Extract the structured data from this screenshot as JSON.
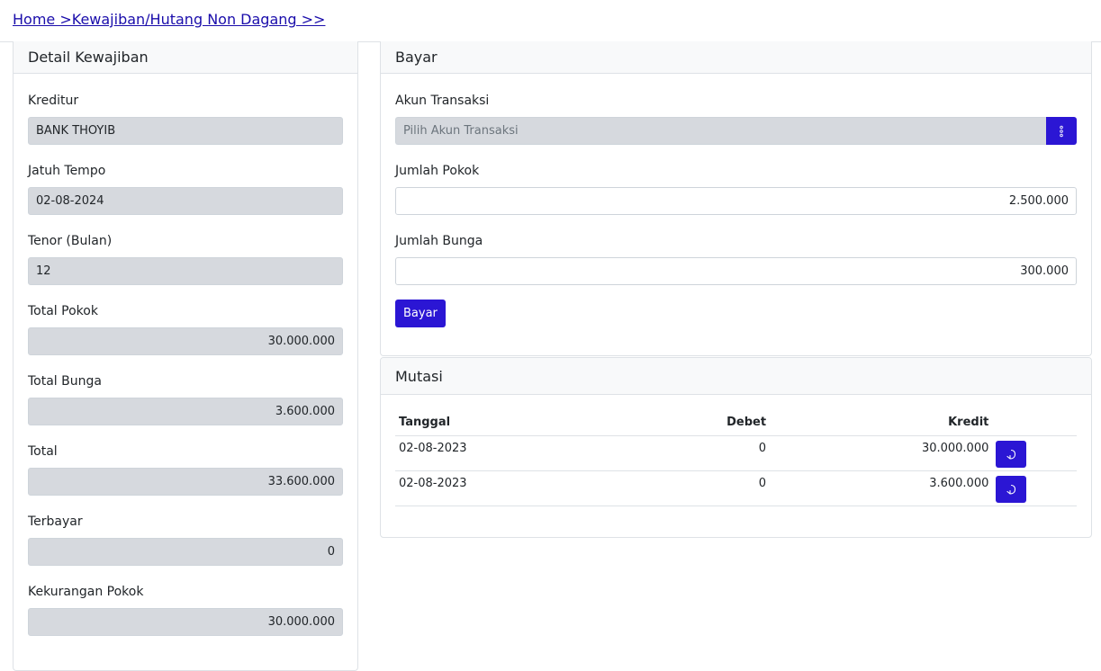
{
  "breadcrumb": "Home >Kewajiban/Hutang Non Dagang >>",
  "detail": {
    "title": "Detail Kewajiban",
    "fields": [
      {
        "label": "Kreditur",
        "value": "BANK THOYIB",
        "align": "left"
      },
      {
        "label": "Jatuh Tempo",
        "value": "02-08-2024",
        "align": "left"
      },
      {
        "label": "Tenor (Bulan)",
        "value": "12",
        "align": "left"
      },
      {
        "label": "Total Pokok",
        "value": "30.000.000",
        "align": "right"
      },
      {
        "label": "Total Bunga",
        "value": "3.600.000",
        "align": "right"
      },
      {
        "label": "Total",
        "value": "33.600.000",
        "align": "right"
      },
      {
        "label": "Terbayar",
        "value": "0",
        "align": "right"
      },
      {
        "label": "Kekurangan Pokok",
        "value": "30.000.000",
        "align": "right"
      }
    ]
  },
  "bayar": {
    "title": "Bayar",
    "akun_label": "Akun Transaksi",
    "akun_placeholder": "Pilih Akun Transaksi",
    "pokok_label": "Jumlah Pokok",
    "pokok_value": "2.500.000",
    "bunga_label": "Jumlah Bunga",
    "bunga_value": "300.000",
    "button_label": "Bayar"
  },
  "mutasi": {
    "title": "Mutasi",
    "headers": {
      "tanggal": "Tanggal",
      "debet": "Debet",
      "kredit": "Kredit"
    },
    "rows": [
      {
        "tanggal": "02-08-2023",
        "debet": "0",
        "kredit": "30.000.000"
      },
      {
        "tanggal": "02-08-2023",
        "debet": "0",
        "kredit": "3.600.000"
      }
    ]
  },
  "colors": {
    "primary": "#2b16d4",
    "readonly_bg": "#d6d9de",
    "link": "#1a0dab"
  }
}
